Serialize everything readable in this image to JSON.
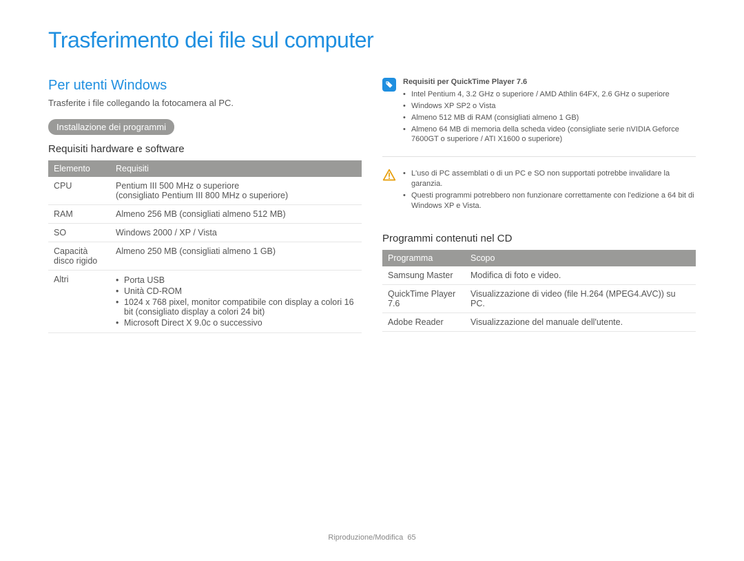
{
  "title": "Trasferimento dei file sul computer",
  "left": {
    "heading": "Per utenti Windows",
    "intro": "Trasferite i file collegando la fotocamera al PC.",
    "pill": "Installazione dei programmi",
    "subheading": "Requisiti hardware e software",
    "table": {
      "headers": [
        "Elemento",
        "Requisiti"
      ],
      "rows": [
        {
          "el": "CPU",
          "req": "Pentium III 500 MHz o superiore\n(consigliato Pentium III 800 MHz o superiore)"
        },
        {
          "el": "RAM",
          "req": "Almeno 256 MB (consigliati almeno 512 MB)"
        },
        {
          "el": "SO",
          "req": "Windows 2000 / XP / Vista"
        },
        {
          "el": "Capacità disco rigido",
          "req": "Almeno 250 MB (consigliati almeno 1 GB)"
        },
        {
          "el": "Altri",
          "list": [
            "Porta USB",
            "Unità CD-ROM",
            "1024 x 768 pixel, monitor compatibile con display a colori 16 bit (consigliato display a colori 24 bit)",
            "Microsoft Direct X 9.0c o successivo"
          ]
        }
      ]
    }
  },
  "right": {
    "info_title": "Requisiti per QuickTime Player 7.6",
    "info_items": [
      "Intel Pentium 4, 3.2 GHz o superiore / AMD Athlin 64FX, 2.6 GHz o superiore",
      "Windows XP SP2 o Vista",
      "Almeno 512 MB di RAM (consigliati almeno 1 GB)",
      "Almeno 64 MB di memoria della scheda video (consigliate serie nVIDIA Geforce 7600GT o superiore / ATI X1600 o superiore)"
    ],
    "warn_items": [
      "L'uso di PC assemblati o di un PC e SO non supportati potrebbe invalidare la garanzia.",
      "Questi programmi potrebbero non funzionare correttamente con l'edizione a 64 bit di Windows XP e Vista."
    ],
    "programs_heading": "Programmi contenuti nel CD",
    "programs_table": {
      "headers": [
        "Programma",
        "Scopo"
      ],
      "rows": [
        {
          "p": "Samsung Master",
          "s": "Modifica di foto e video."
        },
        {
          "p": "QuickTime Player 7.6",
          "s": "Visualizzazione di video (file H.264 (MPEG4.AVC)) su PC."
        },
        {
          "p": "Adobe Reader",
          "s": "Visualizzazione del manuale dell'utente."
        }
      ]
    }
  },
  "footer": {
    "section": "Riproduzione/Modifica",
    "page": "65"
  }
}
